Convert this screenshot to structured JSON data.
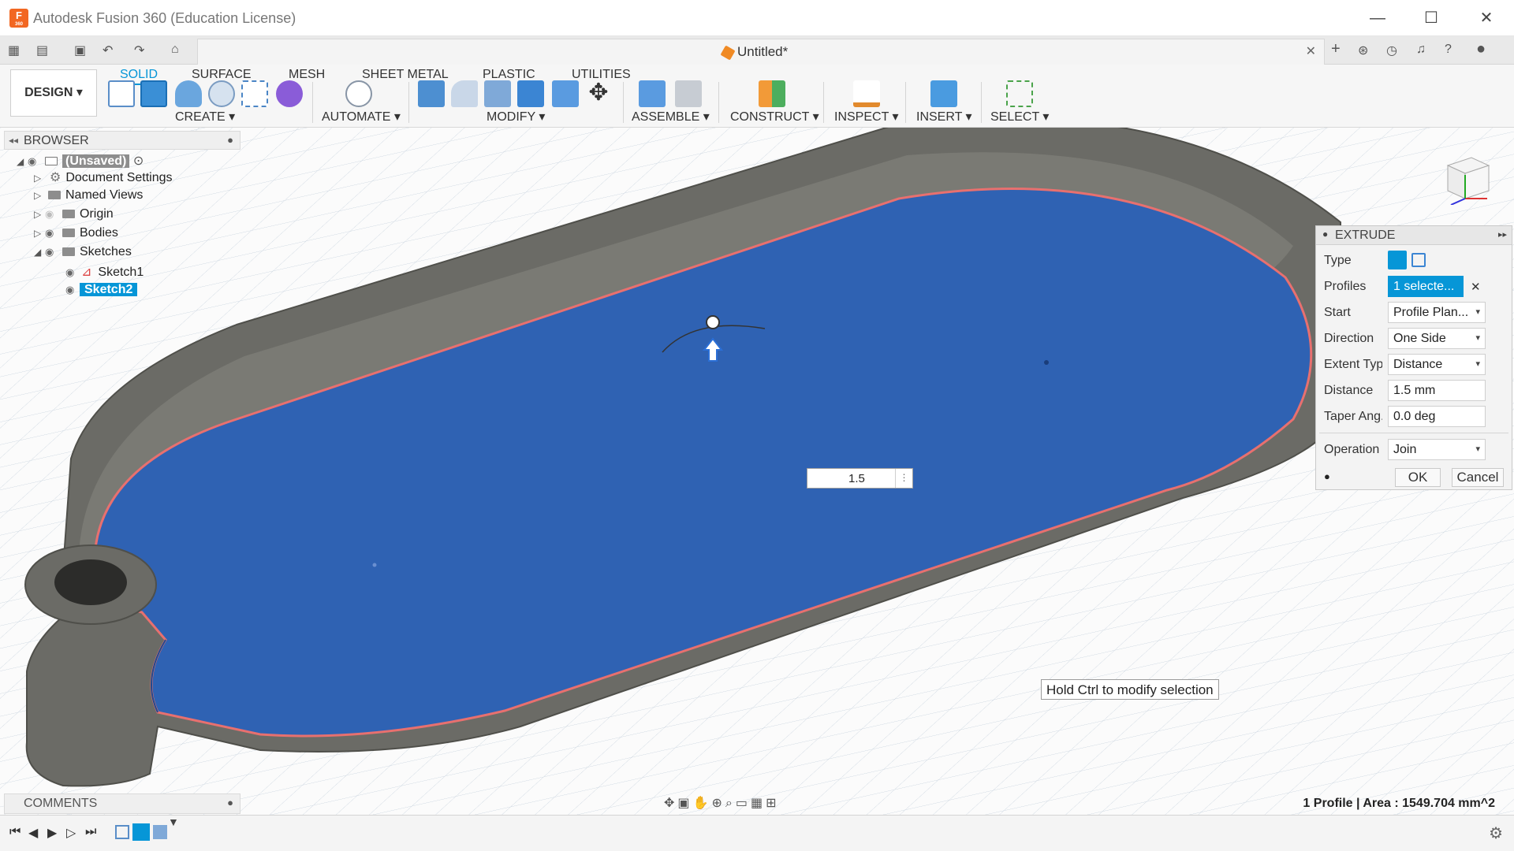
{
  "window": {
    "title": "Autodesk Fusion 360 (Education License)",
    "logo_letter": "F",
    "logo_sub": "360",
    "minimize": "—",
    "maximize": "☐",
    "close": "✕"
  },
  "doc_tab": {
    "title": "Untitled*",
    "close": "✕"
  },
  "ribbon": {
    "workspace_button": "DESIGN ▾",
    "tabs": [
      "SOLID",
      "SURFACE",
      "MESH",
      "SHEET METAL",
      "PLASTIC",
      "UTILITIES"
    ],
    "groups": [
      "CREATE ▾",
      "AUTOMATE ▾",
      "MODIFY ▾",
      "ASSEMBLE ▾",
      "CONSTRUCT ▾",
      "INSPECT ▾",
      "INSERT ▾",
      "SELECT ▾"
    ]
  },
  "browser": {
    "title": "BROWSER",
    "items": [
      {
        "label": "(Unsaved)"
      },
      {
        "label": "Document Settings"
      },
      {
        "label": "Named Views"
      },
      {
        "label": "Origin"
      },
      {
        "label": "Bodies"
      },
      {
        "label": "Sketches"
      },
      {
        "label": "Sketch1"
      },
      {
        "label": "Sketch2"
      }
    ]
  },
  "extrude": {
    "title": "EXTRUDE",
    "rows": {
      "type": {
        "label": "Type"
      },
      "profiles": {
        "label": "Profiles",
        "value": "1 selecte..."
      },
      "start": {
        "label": "Start",
        "value": "Profile Plan..."
      },
      "direction": {
        "label": "Direction",
        "value": "One Side"
      },
      "extent": {
        "label": "Extent Typ...",
        "value": "Distance"
      },
      "distance": {
        "label": "Distance",
        "value": "1.5 mm"
      },
      "taper": {
        "label": "Taper Ang...",
        "value": "0.0 deg"
      },
      "operation": {
        "label": "Operation",
        "value": "Join"
      }
    },
    "ok": "OK",
    "cancel": "Cancel"
  },
  "distance_input": {
    "value": "1.5"
  },
  "tooltip": "Hold Ctrl to modify selection",
  "comments": {
    "title": "COMMENTS"
  },
  "status": "1 Profile | Area : 1549.704 mm^2",
  "colors": {
    "accent": "#0696d7",
    "profile_fill": "#2f62b3",
    "body_wall": "#6b6b66",
    "selection_edge": "#e8706f"
  }
}
